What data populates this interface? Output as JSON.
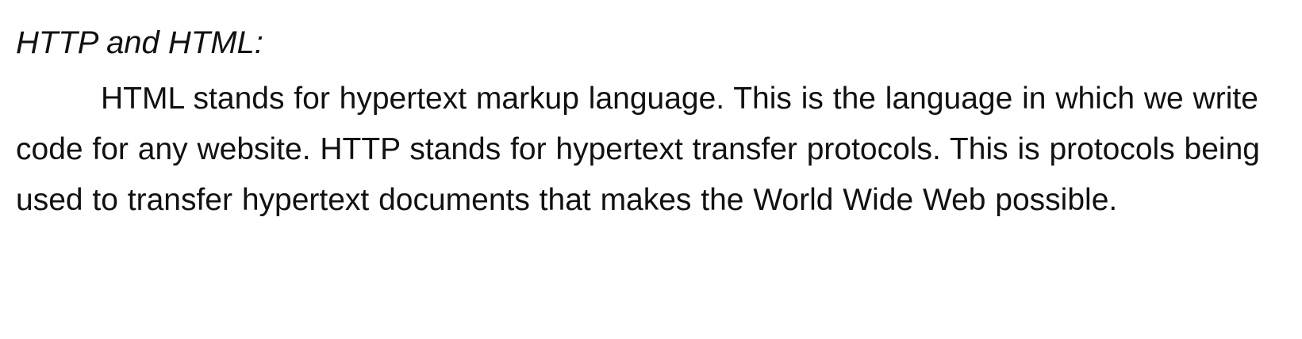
{
  "document": {
    "heading": "HTTP and HTML:",
    "paragraph": "HTML stands for hypertext markup language. This is the language in which we write code for any website. HTTP stands for hypertext transfer protocols. This is protocols being used to transfer hypertext documents that makes the World Wide Web possible."
  }
}
